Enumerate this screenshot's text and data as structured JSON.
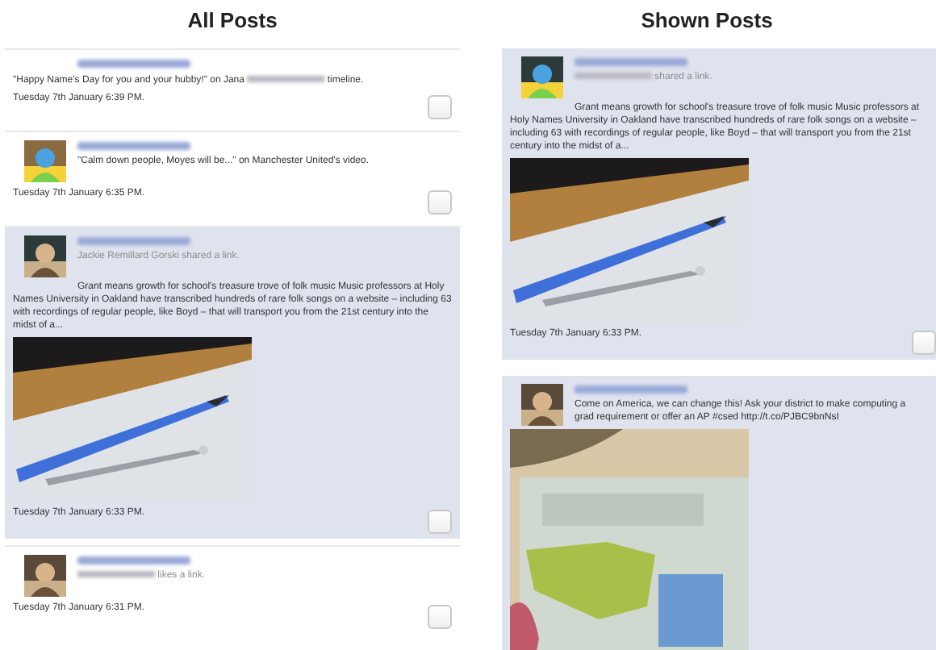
{
  "columns": [
    {
      "heading": "All Posts",
      "posts": [
        {
          "kind": "comment",
          "selected": false,
          "checked": false,
          "message": [
            {
              "kind": "text",
              "text": "\"Happy Name's Day for you and your hubby!\" on Jana "
            },
            {
              "kind": "blurred"
            },
            {
              "kind": "text",
              "text": " timeline."
            }
          ],
          "date": "Tuesday 7th January 6:39 PM."
        },
        {
          "kind": "comment",
          "selected": false,
          "avatar": {
            "kind": "picture"
          },
          "checked": false,
          "message": [
            {
              "kind": "text",
              "text": "\"Calm down people, Moyes will be...\" on Manchester United's video."
            }
          ],
          "date": "Tuesday 7th January 6:35 PM."
        },
        {
          "kind": "share",
          "selected": true,
          "avatar": {
            "kind": "picture"
          },
          "checked": false,
          "actor": [
            {
              "kind": "text",
              "text": "Jackie Remillard Gorski shared a link."
            }
          ],
          "message": [
            {
              "kind": "text",
              "text": "Grant means growth for school's treasure trove of folk music Music professors at Holy Names University in Oakland have transcribed hundreds of rare folk songs on a website – including 63 with recordings of regular people, like Boyd – that will transport you from the 21st century into the midst of a..."
            }
          ],
          "attachment": {
            "kind": "picture"
          },
          "date": "Tuesday 7th January 6:33 PM."
        },
        {
          "kind": "like",
          "selected": false,
          "avatar": {
            "kind": "picture"
          },
          "checked": false,
          "actor": [
            {
              "kind": "blurred"
            },
            {
              "kind": "text",
              "text": " likes a link."
            }
          ],
          "date": "Tuesday 7th January 6:31 PM."
        }
      ]
    },
    {
      "heading": "Shown Posts",
      "posts": [
        {
          "kind": "share",
          "selected": true,
          "avatar": {
            "kind": "picture"
          },
          "checked": false,
          "actor": [
            {
              "kind": "blurred"
            },
            {
              "kind": "text",
              "text": " shared a link."
            }
          ],
          "message": [
            {
              "kind": "text",
              "text": "Grant means growth for school's treasure trove of folk music Music professors at Holy Names University in Oakland have transcribed hundreds of rare folk songs on a website – including 63 with recordings of regular people, like Boyd – that will transport you from the 21st century into the midst of a..."
            }
          ],
          "attachment": {
            "kind": "picture"
          },
          "date": "Tuesday 7th January 6:33 PM."
        },
        {
          "kind": "tweet",
          "selected": true,
          "avatar": {
            "kind": "picture"
          },
          "message": [
            {
              "kind": "text",
              "text": "Come on America, we can change this! Ask your district to make computing a grad requirement or offer an AP #csed http://t.co/PJBC9bnNsI"
            }
          ],
          "attachment": {
            "kind": "picture"
          }
        }
      ]
    }
  ]
}
